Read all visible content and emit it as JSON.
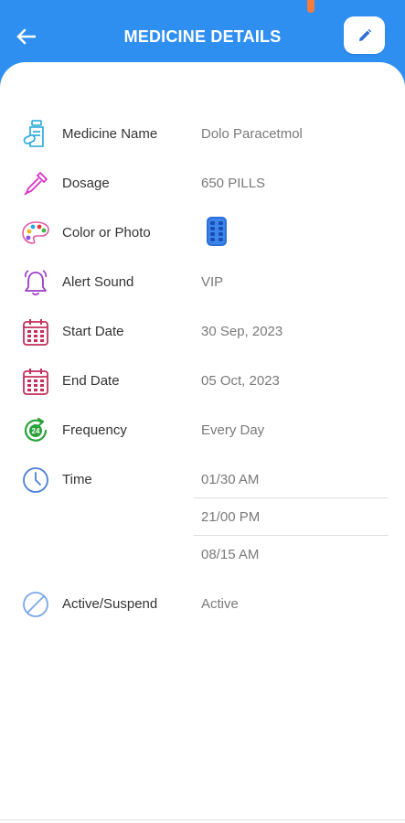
{
  "header": {
    "title": "MEDICINE DETAILS"
  },
  "colors": {
    "primary": "#2f8ff0",
    "label": "#333333",
    "value": "#7a7a7a"
  },
  "details": {
    "medicine_name": {
      "label": "Medicine Name",
      "value": "Dolo Paracetmol",
      "icon": "medicine-bottle-icon"
    },
    "dosage": {
      "label": "Dosage",
      "value": "650 PILLS",
      "icon": "dropper-icon"
    },
    "color_photo": {
      "label": "Color or Photo",
      "icon": "palette-icon",
      "preview_icon": "pill-blister-icon"
    },
    "alert_sound": {
      "label": "Alert Sound",
      "value": "VIP",
      "icon": "bell-icon"
    },
    "start_date": {
      "label": "Start Date",
      "value": "30 Sep, 2023",
      "icon": "calendar-icon"
    },
    "end_date": {
      "label": "End Date",
      "value": "05 Oct, 2023",
      "icon": "calendar-icon"
    },
    "frequency": {
      "label": "Frequency",
      "value": "Every Day",
      "icon": "24-hour-icon"
    },
    "time": {
      "label": "Time",
      "icon": "clock-icon",
      "values": [
        "01/30 AM",
        "21/00 PM",
        "08/15 AM"
      ]
    },
    "active": {
      "label": "Active/Suspend",
      "value": "Active",
      "icon": "block-icon"
    }
  }
}
